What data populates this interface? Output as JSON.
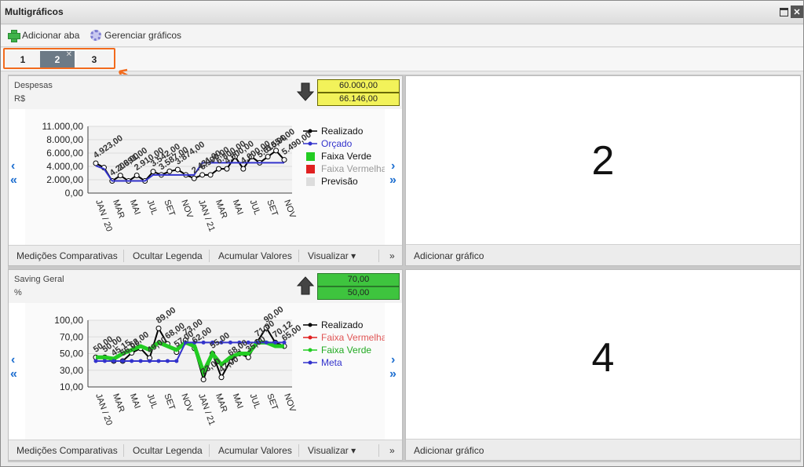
{
  "window": {
    "title": "Multigráficos"
  },
  "toolbar": {
    "add_tab": "Adicionar aba",
    "manage_charts": "Gerenciar gráficos"
  },
  "tabs": [
    {
      "label": "1"
    },
    {
      "label": "2",
      "active": true
    },
    {
      "label": "3"
    }
  ],
  "panels": [
    {
      "name": "Despesas",
      "unit": "R$",
      "trend": "down",
      "values": [
        "60.000,00",
        "66.146,00"
      ],
      "value_color": "#f2f25a",
      "chart_data": {
        "type": "line",
        "yticks": [
          "11.000,00",
          "8.000,00",
          "6.000,00",
          "4.000,00",
          "2.000,00",
          "0,00"
        ],
        "ylim": [
          0,
          11000
        ],
        "xticks": [
          "JAN / 20",
          "MAR",
          "MAI",
          "JUL",
          "SET",
          "NOV",
          "JAN / 21",
          "MAR",
          "MAI",
          "JUL",
          "SET",
          "NOV"
        ],
        "legend": [
          "Realizado",
          "Orçado",
          "Faixa Verde",
          "Faixa Vermelha",
          "Previsão"
        ],
        "series": [
          {
            "name": "Realizado",
            "color": "#000000",
            "values": [
              4923,
              4200,
              2000,
              2891,
              2000,
              2910,
              2000,
              3542,
              3000,
              3587,
              3874,
              3000,
              2431,
              3000,
              3000,
              4000,
              4000,
              6000,
              4000,
              6000,
              5000,
              6000,
              7000,
              5490
            ]
          },
          {
            "name": "Orçado",
            "color": "#3333cc",
            "values": [
              4500,
              4000,
              2000,
              2000,
              2000,
              2000,
              2000,
              3000,
              3000,
              3000,
              3000,
              3000,
              3000,
              5000,
              5000,
              5000,
              5000,
              5000,
              5000,
              5000,
              5000,
              5000,
              5000,
              5000
            ]
          }
        ],
        "labels": [
          "4.923,00",
          "4.200,00",
          "2.891,00",
          "2.910,00",
          "3.542,00",
          "3.587,00",
          "3.874,00",
          "2.431,00",
          "6.900,00",
          "6.800,00",
          "4.000,00",
          "4.000,00",
          "5.610,00",
          "5.554,00",
          "5.490,00"
        ]
      },
      "footer": [
        "Medições Comparativas",
        "Ocultar Legenda",
        "Acumular Valores",
        "Visualizar ▾",
        "»"
      ]
    },
    {
      "name": "Saving Geral",
      "unit": "%",
      "trend": "up",
      "values": [
        "70,00",
        "50,00"
      ],
      "value_color": "#3ec43e",
      "chart_data": {
        "type": "line",
        "yticks": [
          "100,00",
          "70,00",
          "50,00",
          "30,00",
          "10,00"
        ],
        "ylim": [
          10,
          100
        ],
        "xticks": [
          "JAN / 20",
          "MAR",
          "MAI",
          "JUL",
          "SET",
          "NOV",
          "JAN / 21",
          "MAR",
          "MAI",
          "JUL",
          "SET",
          "NOV"
        ],
        "legend": [
          "Realizado",
          "Faixa Vermelha",
          "Faixa Verde",
          "Meta"
        ],
        "series": [
          {
            "name": "Realizado",
            "color": "#000000",
            "values": [
              50,
              50,
              45,
              45,
              56,
              62,
              49,
              89,
              68,
              57,
              73,
              62,
              20,
              55,
              23,
              45,
              55,
              50,
              71,
              90,
              70,
              65
            ]
          },
          {
            "name": "Faixa Verde",
            "color": "#22cc22",
            "values": [
              50,
              50,
              48,
              55,
              60,
              65,
              60,
              70,
              65,
              60,
              70,
              65,
              30,
              55,
              40,
              50,
              55,
              55,
              70,
              70,
              65,
              65
            ]
          },
          {
            "name": "Meta",
            "color": "#3333cc",
            "values": [
              45,
              45,
              45,
              45,
              45,
              45,
              45,
              45,
              45,
              45,
              70,
              70,
              70,
              70,
              70,
              70,
              70,
              70,
              70,
              70,
              70,
              70
            ]
          }
        ],
        "labels": [
          "50,00",
          "50,00",
          "45,15",
          "56,00",
          "62,00",
          "49,00",
          "89,00",
          "68,00",
          "57,00",
          "73,00",
          "62,00",
          "23,00",
          "55,00",
          "47,00",
          "68,00",
          "35,00",
          "71,00",
          "90,00",
          "70,12",
          "65,00"
        ]
      },
      "footer": [
        "Medições Comparativas",
        "Ocultar Legenda",
        "Acumular Valores",
        "Visualizar ▾",
        "»"
      ]
    }
  ],
  "empty_panels": [
    {
      "number": "2",
      "add_label": "Adicionar gráfico"
    },
    {
      "number": "4",
      "add_label": "Adicionar gráfico"
    }
  ],
  "colors": {
    "tab_highlight": "#f26b1d",
    "active_tab": "#6c7a86",
    "nav_arrow": "#1e6fd0"
  }
}
